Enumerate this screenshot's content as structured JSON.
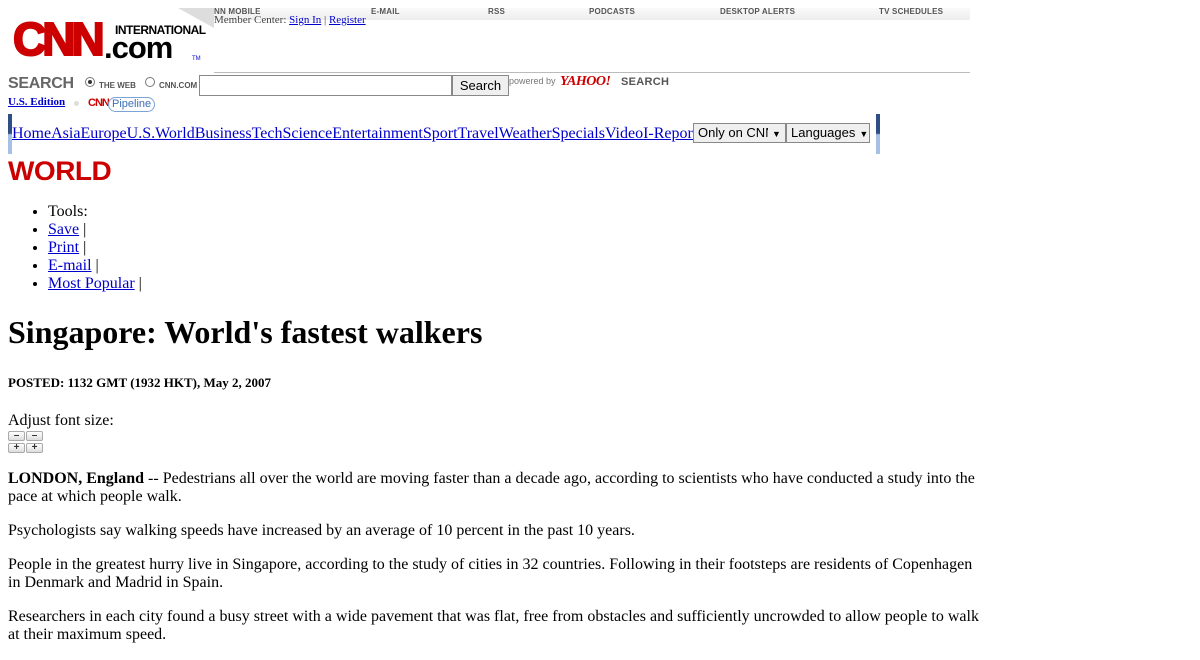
{
  "logo": {
    "cnn": "CNN",
    "international": "INTERNATIONAL",
    "dotcom": ".com",
    "tm": "TM"
  },
  "topnav": {
    "items": [
      "CNN MOBILE",
      "E-MAIL",
      "RSS",
      "PODCASTS",
      "DESKTOP ALERTS",
      "TV SCHEDULES"
    ]
  },
  "member": {
    "label": "Member Center:",
    "sign_in": "Sign In",
    "separator": "|",
    "register": "Register"
  },
  "search": {
    "label": "SEARCH",
    "option_web": "THE WEB",
    "option_cnn": "CNN.COM",
    "selected": "THE WEB",
    "value": "",
    "button": "Search",
    "powered_by": "powered by",
    "yahoo": "YAHOO!",
    "yahoo_search": "SEARCH"
  },
  "edition": {
    "label": "U.S. Edition",
    "pipeline_brand": "CNN",
    "pipeline_name": "Pipeline"
  },
  "mainnav": {
    "links": [
      "Home",
      "Asia",
      "Europe",
      "U.S.",
      "World",
      "Business",
      "Tech",
      "Science",
      "Entertainment",
      "Sport",
      "Travel",
      "Weather",
      "Specials",
      "Video",
      "I-Reports"
    ],
    "only_on_cnn": "Only on CNN",
    "languages": "Languages"
  },
  "section": {
    "title": "WORLD"
  },
  "tools": {
    "label": "Tools:",
    "items": [
      "Save",
      "Print",
      "E-mail",
      "Most Popular"
    ],
    "separator": "|"
  },
  "article": {
    "headline": "Singapore: World's fastest walkers",
    "posted": "POSTED: 1132 GMT (1932 HKT), May 2, 2007",
    "adjust_font": "Adjust font size:",
    "dateline": "LONDON, England",
    "paragraphs": [
      " -- Pedestrians all over the world are moving faster than a decade ago, according to scientists who have conducted a study into the pace at which people walk.",
      "Psychologists say walking speeds have increased by an average of 10 percent in the past 10 years.",
      "People in the greatest hurry live in Singapore, according to the study of cities in 32 countries. Following in their footsteps are residents of Copenhagen in Denmark and Madrid in Spain.",
      "Researchers in each city found a busy street with a wide pavement that was flat, free from obstacles and sufficiently uncrowded to allow people to walk at their maximum speed."
    ]
  },
  "colors": {
    "brand_red": "#cc0000",
    "link_blue": "#0000cc",
    "nav_dark": "#2d4f86",
    "nav_light": "#a7c1e6"
  }
}
